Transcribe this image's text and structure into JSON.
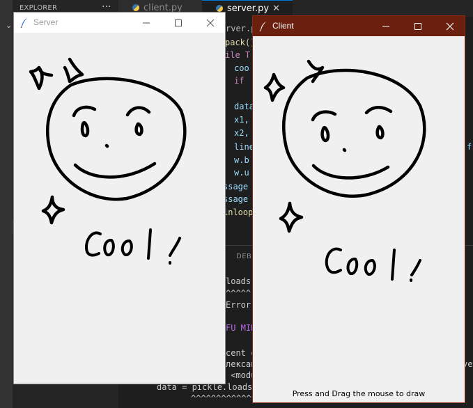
{
  "vscode": {
    "explorer_title": "EXPLORER",
    "explorer_more": "···",
    "tabs": [
      {
        "label": "client.py"
      },
      {
        "label": "server.py",
        "close": "✕"
      }
    ],
    "breadcrumb": "rver.py",
    "code_lines": [
      "pack()",
      "ile T",
      "coo",
      "if",
      "",
      "data",
      "x1,",
      "x2,",
      "line",
      "w.b",
      "w.u",
      "ssage",
      "ssage",
      "inloop"
    ],
    "trailing_char": "f",
    "debug_label": "DEBU",
    "terminal_lines": [
      "loads(",
      "^^^^^",
      "Error:",
      "",
      "FU MIN",
      "",
      "cent c",
      "лексан",
      " <modu",
      "data = pickle.loads(",
      "^^^^^^^^^^^^^^^^"
    ],
    "terminal_trailing": "ve"
  },
  "server_window": {
    "title": "Server",
    "drawing_text": "Cool!"
  },
  "client_window": {
    "title": "Client",
    "drawing_text": "Cool!",
    "status": "Press and Drag the mouse to draw"
  },
  "colors": {
    "client_titlebar": "#6b1f0f",
    "canvas_bg": "#f0f0f0",
    "ink": "#000000",
    "editor_bg": "#1e1e1e"
  },
  "icons": [
    "feather-icon",
    "minimize-icon",
    "maximize-icon",
    "close-icon",
    "python-file-icon"
  ]
}
